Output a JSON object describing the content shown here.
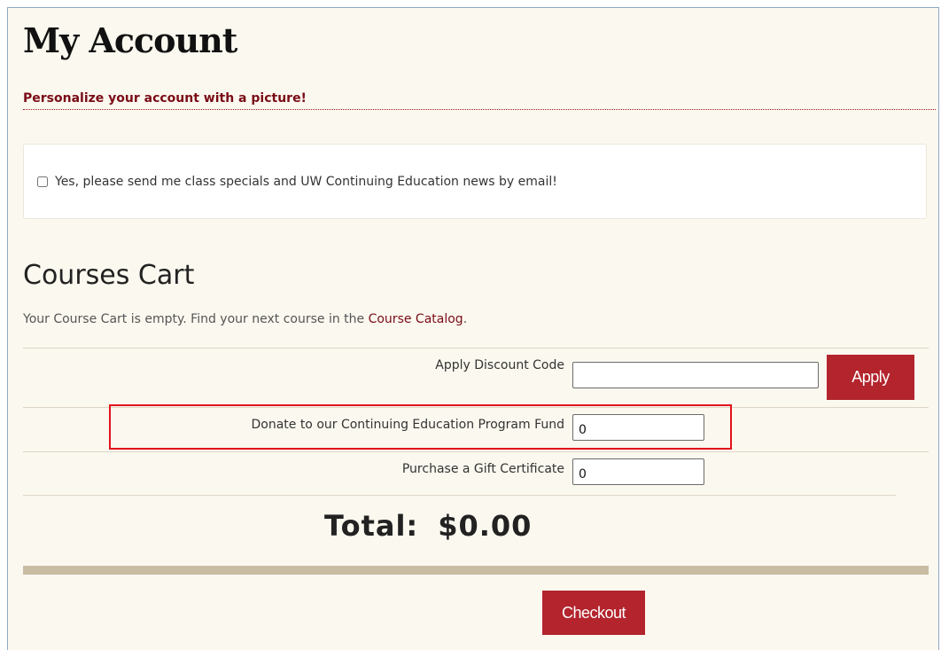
{
  "header": {
    "title": "My Account",
    "picture_link": "Personalize your account with a picture!"
  },
  "newsletter": {
    "checked": false,
    "label": "Yes, please send me class specials and UW Continuing Education news by email!"
  },
  "cart": {
    "title": "Courses Cart",
    "empty_text": "Your Course Cart is empty. Find your next course in the ",
    "catalog_link": "Course Catalog",
    "empty_suffix": ".",
    "discount_label": "Apply Discount Code",
    "discount_value": "",
    "apply_label": "Apply",
    "donate_label": "Donate to our Continuing Education Program Fund",
    "donate_value": "0",
    "gift_label": "Purchase a Gift Certificate",
    "gift_value": "0",
    "total_label": "Total:",
    "total_value": "$0.00",
    "checkout_label": "Checkout"
  },
  "colors": {
    "accent": "#b3242d",
    "link": "#7a0c16",
    "highlight": "#e2121b",
    "page_bg": "#fbf8ef"
  }
}
